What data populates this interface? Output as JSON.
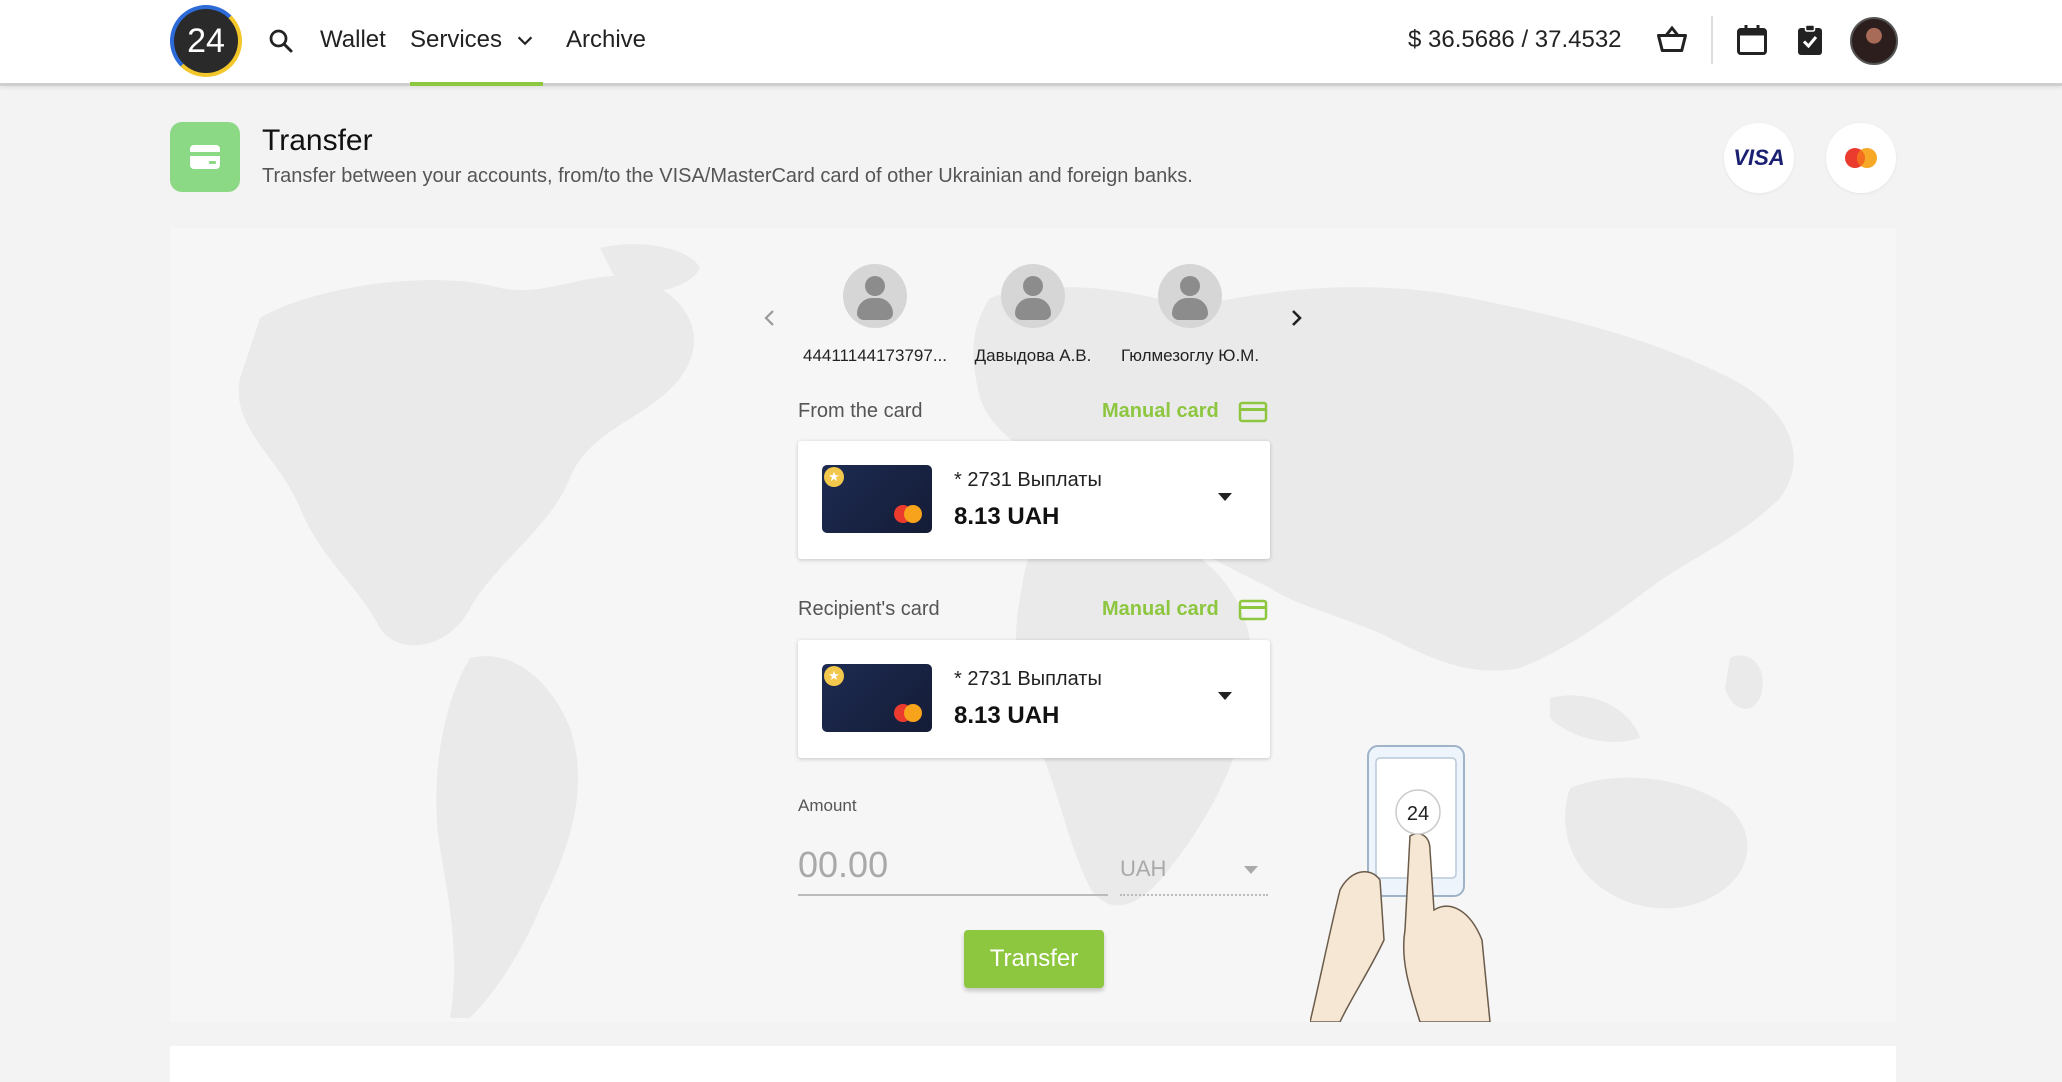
{
  "header": {
    "logo_text": "24",
    "nav": {
      "wallet": "Wallet",
      "services": "Services",
      "archive": "Archive"
    },
    "rate": "$  36.5686 / 37.4532",
    "icons": [
      "search-icon",
      "chevron-down-icon",
      "basket-icon",
      "calendar-icon",
      "clipboard-check-icon",
      "avatar"
    ]
  },
  "page": {
    "title": "Transfer",
    "subtitle": "Transfer between your accounts, from/to the VISA/MasterCard card of other Ukrainian and foreign banks.",
    "visa_label": "VISA"
  },
  "contacts": [
    {
      "name": "44411144173797..."
    },
    {
      "name": "Давыдова А.В."
    },
    {
      "name": "Гюлмезоглу Ю.М."
    }
  ],
  "from": {
    "label": "From the card",
    "manual": "Manual card",
    "card_number": "* 2731  Выплаты",
    "balance": "8.13 UAH"
  },
  "to": {
    "label": "Recipient's card",
    "manual": "Manual card",
    "card_number": "* 2731  Выплаты",
    "balance": "8.13 UAH"
  },
  "amount": {
    "label": "Amount",
    "placeholder": "00.00",
    "currency": "UAH"
  },
  "transfer_button": "Transfer",
  "illustration_text": "24",
  "colors": {
    "accent": "#8dc63f",
    "title_icon": "#8bd984",
    "card": "#1d2b52"
  }
}
